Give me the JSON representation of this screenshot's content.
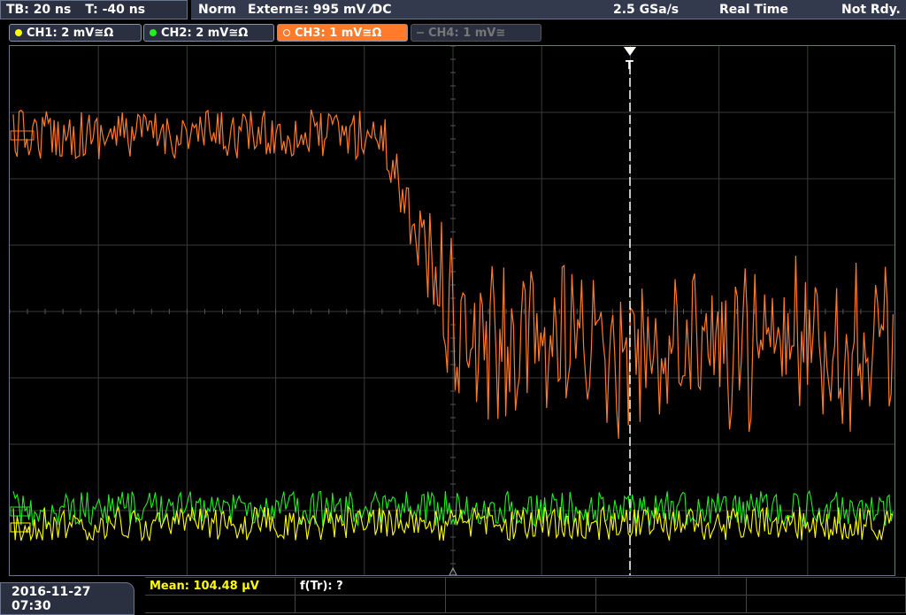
{
  "status_bar": {
    "timebase": "TB: 20 ns",
    "trigger_offset": "T: -40 ns",
    "trigger_mode": "Norm",
    "trigger_source": "Extern≅: 995 mV ⁄DC",
    "sample_rate": "2.5 GSa/s",
    "acq_mode": "Real Time",
    "acq_status": "Not Rdy."
  },
  "channels": [
    {
      "label": "CH1: 2 mV≅Ω",
      "color": "#ffff00",
      "active": true
    },
    {
      "label": "CH2: 2 mV≅Ω",
      "color": "#22ee22",
      "active": true
    },
    {
      "label": "CH3: 1 mV≅Ω",
      "color": "#ff7a2a",
      "active": true,
      "selected": true
    },
    {
      "label": "CH4: 1 mV≅",
      "color": "#666666",
      "active": false
    }
  ],
  "screen": {
    "trigger_marker": "T",
    "ch3_ref_marker": "",
    "ch1_ref_marker": "",
    "ch2_ref_marker": ""
  },
  "bottom_bar": {
    "datetime": "2016-11-27 07:30",
    "measurement_mean": "Mean: 104.48 µV",
    "measurement_ftr": "f(Tr): ?"
  }
}
